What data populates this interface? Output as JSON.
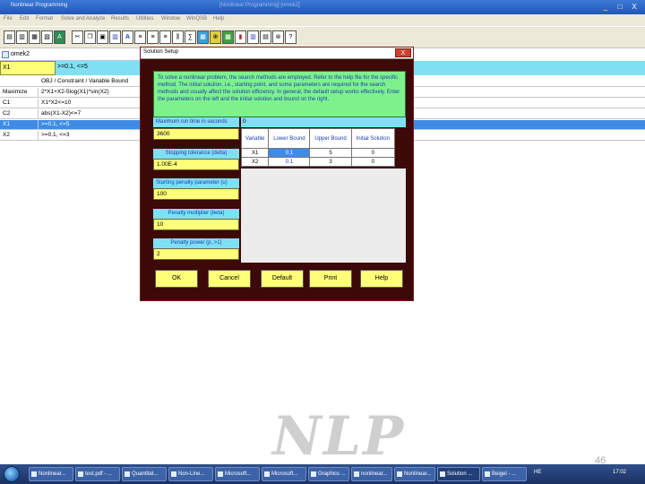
{
  "window": {
    "title": "Nonlinear Programming",
    "ghost_title": "[Nonlinear Programming] [omek2]",
    "controls": [
      "_",
      "□",
      "X"
    ]
  },
  "menu": [
    "File",
    "Edit",
    "Format",
    "Solve and Analyze",
    "Results",
    "Utilities",
    "Window",
    "WinQSB",
    "Help"
  ],
  "toolbar_icons": [
    "new-icon",
    "open-icon",
    "save-icon",
    "print-icon",
    "font-icon",
    "cut-icon",
    "copy-icon",
    "paste-icon",
    "chart-icon",
    "bold-icon",
    "align-left-icon",
    "align-center-icon",
    "align-right-icon",
    "column-icon",
    "formula-icon",
    "table-icon",
    "zoom-icon",
    "grid-icon",
    "graph-icon",
    "bar-chart-icon",
    "calculator-icon",
    "help-icon",
    "question-icon"
  ],
  "document": {
    "title": "omek2"
  },
  "cellbar": {
    "name": "X1",
    "value": ">=0.1, <=5"
  },
  "grid": {
    "header": "OBJ / Constraint / Variable Bound",
    "rows": [
      {
        "name": "Maximize",
        "value": "2*X1+X2-5log(X1)*sin(X2)",
        "selected": false
      },
      {
        "name": "C1",
        "value": "X1*X2<=10",
        "selected": false
      },
      {
        "name": "C2",
        "value": "abs(X1-X2)<=7",
        "selected": false
      },
      {
        "name": "X1",
        "value": ">=0.1, <=5",
        "selected": true
      },
      {
        "name": "X2",
        "value": ">=0.1, <=3",
        "selected": false
      }
    ]
  },
  "dialog": {
    "title": "Solution Setup",
    "close": "X",
    "info": "To solve a nonlinear problem, the search methods are employed. Refer to the help file for the specific method. The initial solution, i.e., starting point, and some parameters are required for the search methods and usually affect the solution efficiency. In general, the default setup works effectively. Enter the parameters on the left and the initial solution and bound on the right.",
    "params": [
      {
        "label": "Maximum run time in seconds",
        "value": "3600"
      },
      {
        "label": "Stopping tolerance (delta)",
        "value": "1.00E-4"
      },
      {
        "label": "Starting penalty parameter (u)",
        "value": "100"
      },
      {
        "label": "Penalty multiplier (beta)",
        "value": "10"
      },
      {
        "label": "Penalty power (p, >1)",
        "value": "2"
      }
    ],
    "top_strip_value": "0",
    "table": {
      "headers": [
        "Variable",
        "Lower Bound",
        "Upper Bound",
        "Initial Solution"
      ],
      "rows": [
        {
          "variable": "X1",
          "lower": "0.1",
          "upper": "5",
          "initial": "0"
        },
        {
          "variable": "X2",
          "lower": "0.1",
          "upper": "3",
          "initial": "0"
        }
      ]
    },
    "buttons": [
      "OK",
      "Cancel",
      "Default",
      "Print",
      "Help"
    ]
  },
  "slide": {
    "watermark": "NLP",
    "page": "46"
  },
  "taskbar": {
    "items": [
      "Nonlinear...",
      "test.pdf - ...",
      "Quantitat...",
      "Non-Line...",
      "Microsoft...",
      "Microsoft...",
      "Graphics ...",
      "nonlinear...",
      "Nonlinear...",
      "Solution ...",
      "Beigel - ..."
    ],
    "tray": {
      "lang": "HE",
      "time": "17:02"
    }
  }
}
